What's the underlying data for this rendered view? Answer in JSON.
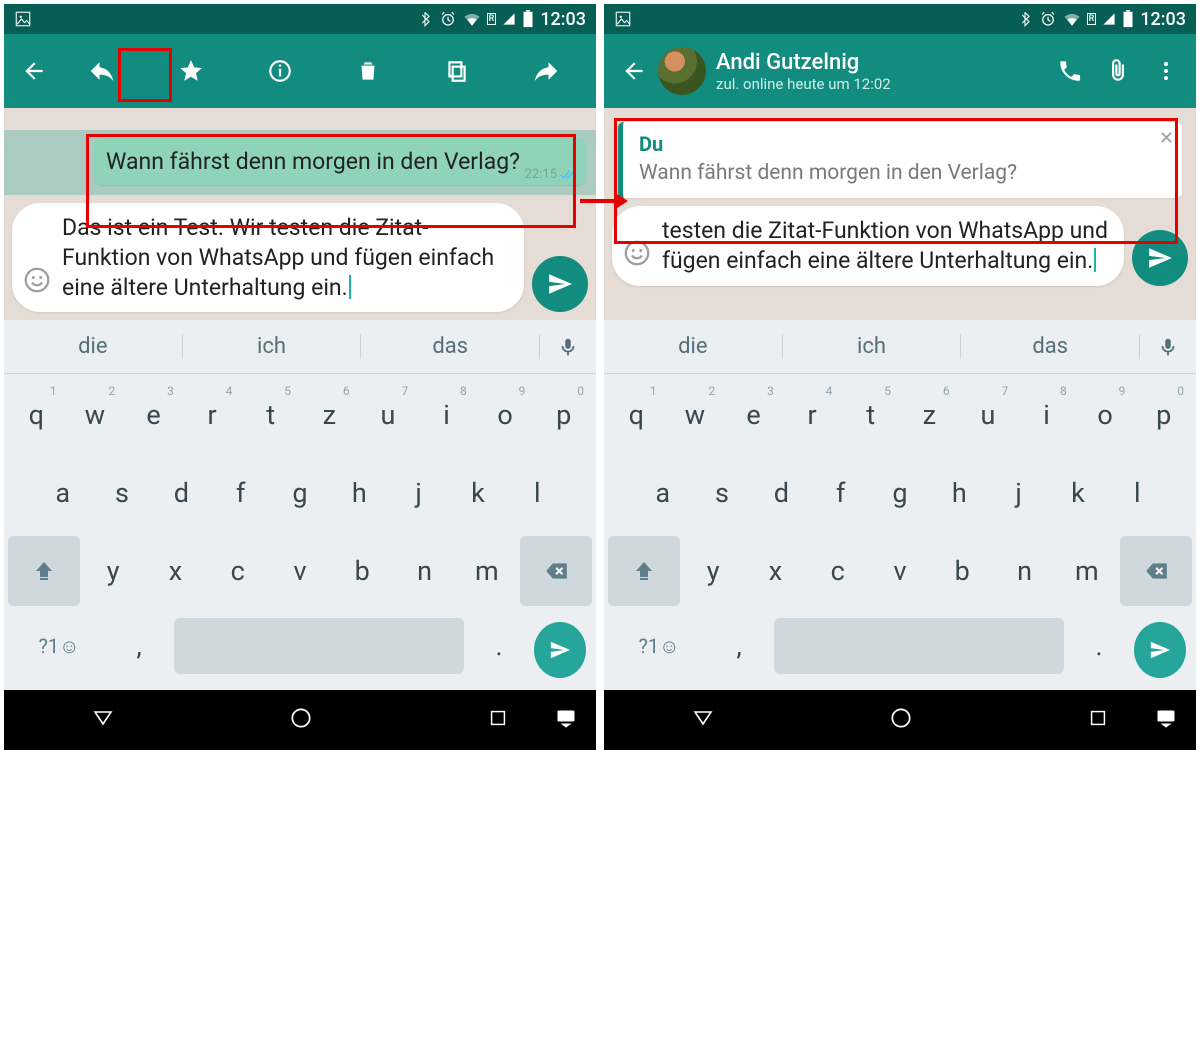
{
  "statusbar": {
    "time": "12:03"
  },
  "left": {
    "toolbar": {
      "back": "←",
      "reply": "↶",
      "star": "★",
      "info": "ⓘ",
      "delete": "🗑",
      "copy": "⧉",
      "forward": "➡"
    },
    "selected_msg": {
      "text": "Wann fährst denn morgen in den Verlag?",
      "time": "22:15"
    },
    "compose": "Das ist ein Test. Wir testen die Zitat-Funktion von WhatsApp und fügen einfach eine ältere Unterhaltung ein."
  },
  "right": {
    "contact": {
      "name": "Andi Gutzelnig",
      "status": "zul. online heute um 12:02"
    },
    "quote": {
      "sender": "Du",
      "text": "Wann fährst denn morgen in den Verlag?"
    },
    "compose_visible": "testen die Zitat-Funktion von WhatsApp und fügen einfach eine ältere Unterhaltung ein."
  },
  "keyboard": {
    "suggestions": [
      "die",
      "ich",
      "das"
    ],
    "row1": [
      {
        "k": "q",
        "h": "1"
      },
      {
        "k": "w",
        "h": "2"
      },
      {
        "k": "e",
        "h": "3"
      },
      {
        "k": "r",
        "h": "4"
      },
      {
        "k": "t",
        "h": "5"
      },
      {
        "k": "z",
        "h": "6"
      },
      {
        "k": "u",
        "h": "7"
      },
      {
        "k": "i",
        "h": "8"
      },
      {
        "k": "o",
        "h": "9"
      },
      {
        "k": "p",
        "h": "0"
      }
    ],
    "row2": [
      "a",
      "s",
      "d",
      "f",
      "g",
      "h",
      "j",
      "k",
      "l"
    ],
    "row3": [
      "y",
      "x",
      "c",
      "v",
      "b",
      "n",
      "m"
    ],
    "sym_label": "?1☺",
    "comma": ",",
    "period": "."
  }
}
